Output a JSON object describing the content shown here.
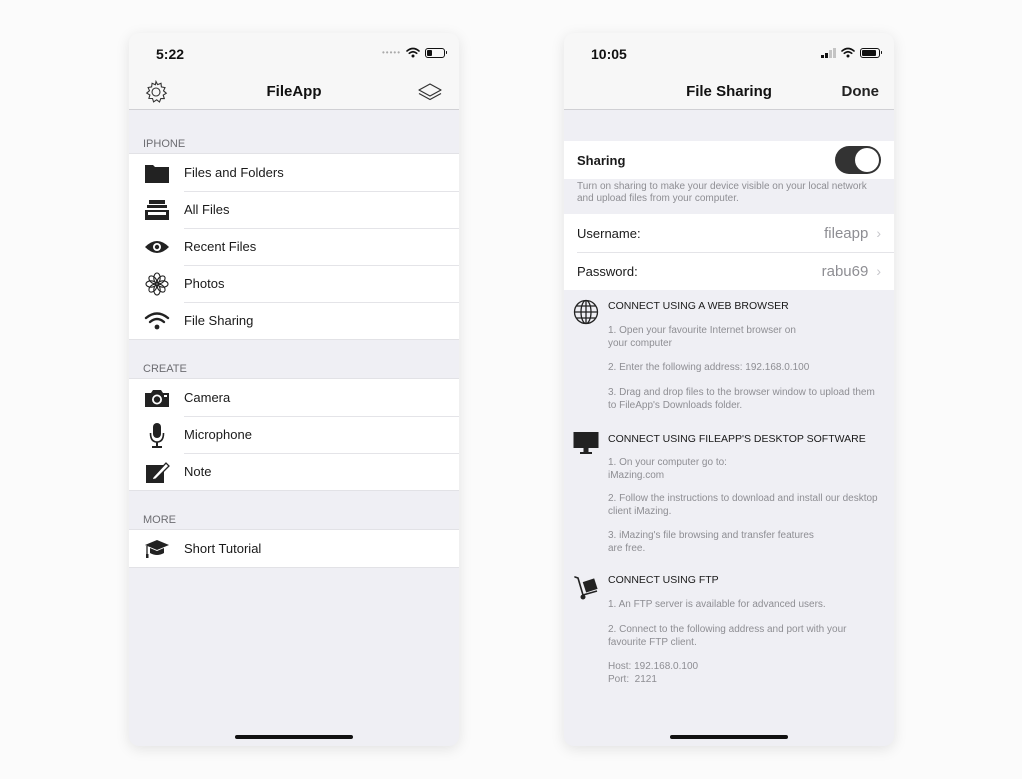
{
  "left_phone": {
    "time": "5:22",
    "title": "FileApp",
    "sections": [
      {
        "header": "IPHONE",
        "items": [
          {
            "label": "Files and Folders",
            "icon": "folder-icon"
          },
          {
            "label": "All Files",
            "icon": "tray-icon"
          },
          {
            "label": "Recent Files",
            "icon": "eye-icon"
          },
          {
            "label": "Photos",
            "icon": "flower-icon"
          },
          {
            "label": "File Sharing",
            "icon": "wifi-icon"
          }
        ]
      },
      {
        "header": "CREATE",
        "items": [
          {
            "label": "Camera",
            "icon": "camera-icon"
          },
          {
            "label": "Microphone",
            "icon": "microphone-icon"
          },
          {
            "label": "Note",
            "icon": "note-icon"
          }
        ]
      },
      {
        "header": "MORE",
        "items": [
          {
            "label": "Short Tutorial",
            "icon": "graduation-cap-icon"
          }
        ]
      }
    ]
  },
  "right_phone": {
    "time": "10:05",
    "title": "File Sharing",
    "done_label": "Done",
    "sharing": {
      "label": "Sharing",
      "enabled": true,
      "footnote": "Turn on sharing to make your device visible on your local network and upload files from your computer."
    },
    "username": {
      "label": "Username:",
      "value": "fileapp"
    },
    "password": {
      "label": "Password:",
      "value": "rabu69"
    },
    "instructions": [
      {
        "title": "CONNECT USING A WEB BROWSER",
        "icon": "globe-icon",
        "steps": [
          "1. Open your favourite Internet browser on\nyour computer",
          "2. Enter the following address: 192.168.0.100",
          "3. Drag and drop files to the browser window to upload them to FileApp's Downloads folder."
        ]
      },
      {
        "title": "CONNECT USING FILEAPP'S DESKTOP SOFTWARE",
        "icon": "monitor-icon",
        "steps": [
          "1. On your computer go to:\niMazing.com",
          "2. Follow the instructions to download and install our desktop client iMazing.",
          "3. iMazing's file browsing and transfer features\nare free."
        ]
      },
      {
        "title": "CONNECT USING FTP",
        "icon": "hand-truck-icon",
        "steps": [
          "1. An FTP server is available for advanced users.",
          "2. Connect to the following address and port with your favourite FTP client.",
          "Host: 192.168.0.100\nPort:  2121"
        ]
      }
    ]
  },
  "colors": {
    "background": "#efeff4",
    "toggle_on": "#333333",
    "secondary_text": "#8e8e93"
  }
}
